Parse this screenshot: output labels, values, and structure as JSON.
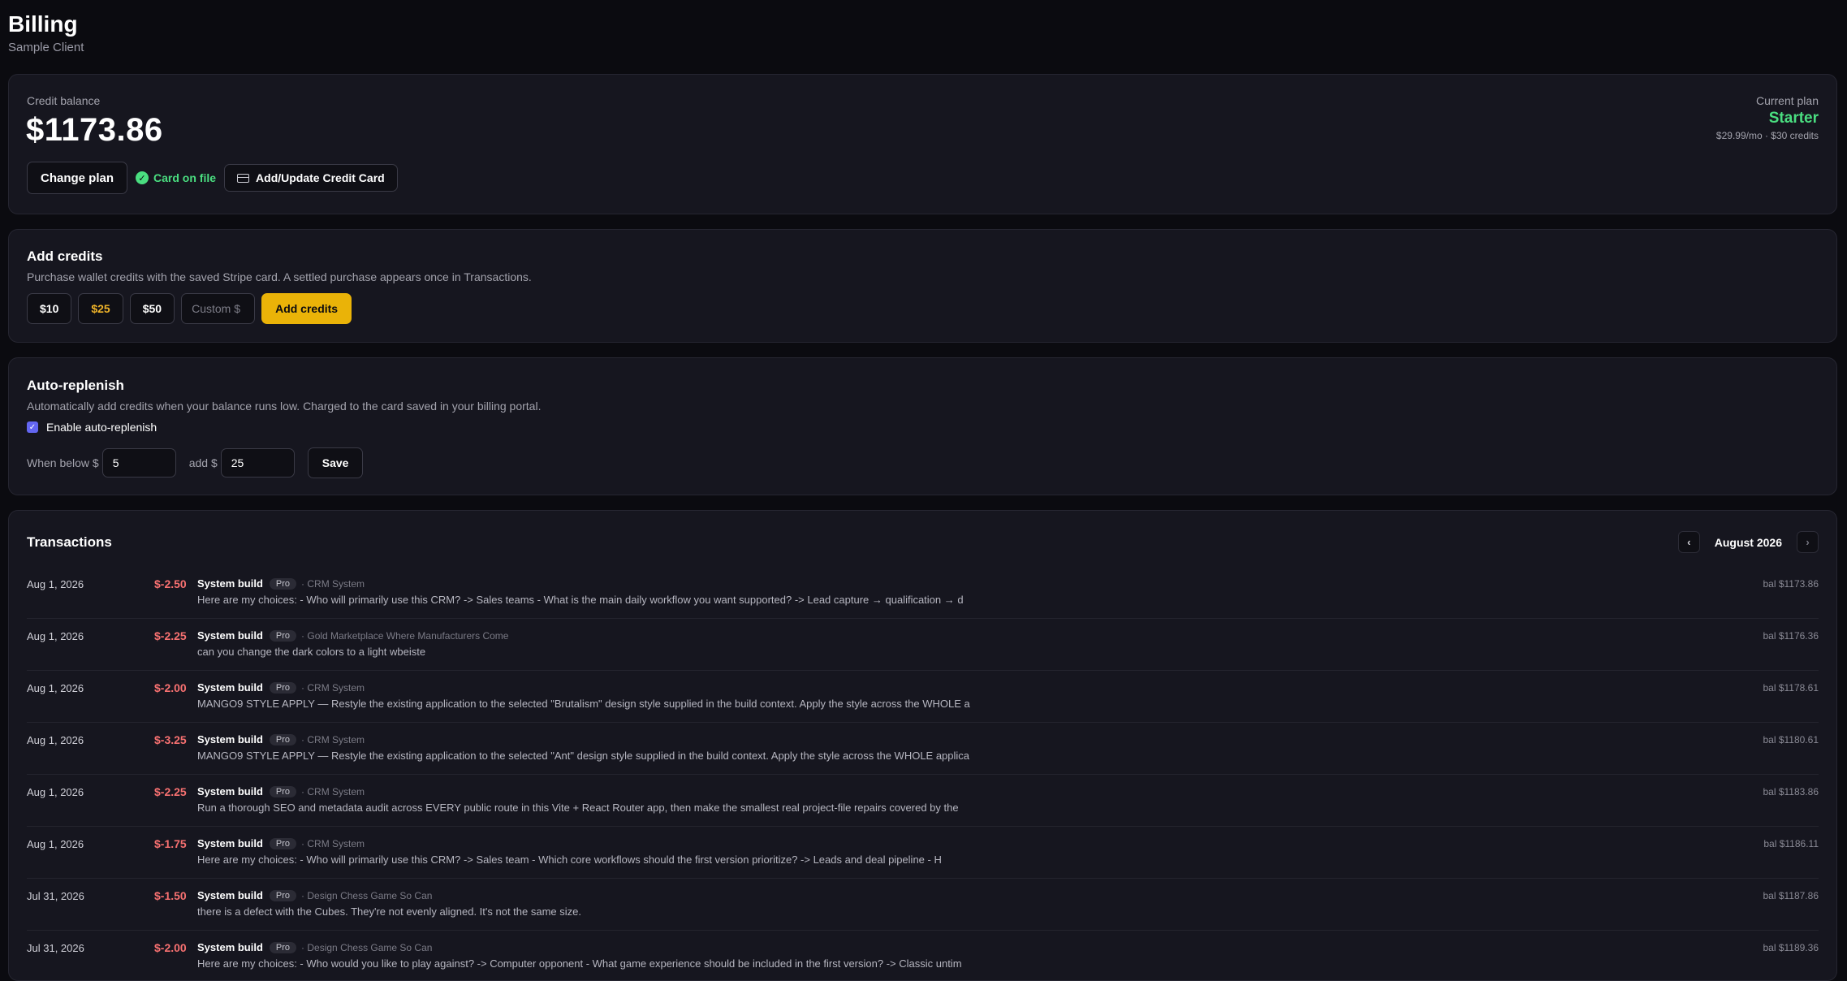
{
  "header": {
    "title": "Billing",
    "subtitle": "Sample Client"
  },
  "balance": {
    "label": "Credit balance",
    "amount": "$1173.86",
    "change_plan_label": "Change plan",
    "card_status": "Card on file",
    "update_card_label": "Add/Update Credit Card",
    "plan_label": "Current plan",
    "plan_name": "Starter",
    "plan_detail": "$29.99/mo · $30 credits"
  },
  "add_credits": {
    "title": "Add credits",
    "description": "Purchase wallet credits with the saved Stripe card. A settled purchase appears once in Transactions.",
    "amounts": [
      "$10",
      "$25",
      "$50"
    ],
    "selected_amount": "$25",
    "custom_placeholder": "Custom $",
    "submit_label": "Add credits"
  },
  "auto_replenish": {
    "title": "Auto-replenish",
    "description": "Automatically add credits when your balance runs low. Charged to the card saved in your billing portal.",
    "enable_label": "Enable auto-replenish",
    "enabled": true,
    "below_label": "When below $",
    "below_value": "5",
    "add_label": "add $",
    "add_value": "25",
    "save_label": "Save"
  },
  "transactions": {
    "title": "Transactions",
    "month": "August 2026",
    "prev_icon": "chevron-left-icon",
    "next_icon": "chevron-right-icon",
    "rows": [
      {
        "date": "Aug 1, 2026",
        "amount": "$-2.50",
        "kind": "System build",
        "badge": "Pro",
        "project": "· CRM System",
        "description": "Here are my choices: - Who will primarily use this CRM? -> Sales teams - What is the main daily workflow you want supported? -> Lead capture → qualification → d",
        "balance": "bal $1173.86"
      },
      {
        "date": "Aug 1, 2026",
        "amount": "$-2.25",
        "kind": "System build",
        "badge": "Pro",
        "project": "· Gold Marketplace Where Manufacturers Come",
        "description": "can you change the dark colors to a light wbeiste",
        "balance": "bal $1176.36"
      },
      {
        "date": "Aug 1, 2026",
        "amount": "$-2.00",
        "kind": "System build",
        "badge": "Pro",
        "project": "· CRM System",
        "description": "MANGO9 STYLE APPLY — Restyle the existing application to the selected \"Brutalism\" design style supplied in the build context. Apply the style across the WHOLE a",
        "balance": "bal $1178.61"
      },
      {
        "date": "Aug 1, 2026",
        "amount": "$-3.25",
        "kind": "System build",
        "badge": "Pro",
        "project": "· CRM System",
        "description": "MANGO9 STYLE APPLY — Restyle the existing application to the selected \"Ant\" design style supplied in the build context. Apply the style across the WHOLE applica",
        "balance": "bal $1180.61"
      },
      {
        "date": "Aug 1, 2026",
        "amount": "$-2.25",
        "kind": "System build",
        "badge": "Pro",
        "project": "· CRM System",
        "description": "Run a thorough SEO and metadata audit across EVERY public route in this Vite + React Router app, then make the smallest real project-file repairs covered by the",
        "balance": "bal $1183.86"
      },
      {
        "date": "Aug 1, 2026",
        "amount": "$-1.75",
        "kind": "System build",
        "badge": "Pro",
        "project": "· CRM System",
        "description": "Here are my choices: - Who will primarily use this CRM? -> Sales team - Which core workflows should the first version prioritize? -> Leads and deal pipeline - H",
        "balance": "bal $1186.11"
      },
      {
        "date": "Jul 31, 2026",
        "amount": "$-1.50",
        "kind": "System build",
        "badge": "Pro",
        "project": "· Design Chess Game So Can",
        "description": "there is a defect with the Cubes. They're not evenly aligned. It's not the same size.",
        "balance": "bal $1187.86"
      },
      {
        "date": "Jul 31, 2026",
        "amount": "$-2.00",
        "kind": "System build",
        "badge": "Pro",
        "project": "· Design Chess Game So Can",
        "description": "Here are my choices: - Who would you like to play against? -> Computer opponent - What game experience should be included in the first version? -> Classic untim",
        "balance": "bal $1189.36"
      }
    ]
  },
  "colors": {
    "background": "#0b0b10",
    "card": "#16161f",
    "accent": "#eab308",
    "positive": "#4ade80",
    "negative": "#f87171",
    "checkbox": "#6366f1"
  },
  "icons": {
    "card_status": "check-circle-icon",
    "update_card": "credit-card-icon",
    "enable_checkbox": "checkbox-checked-icon"
  }
}
